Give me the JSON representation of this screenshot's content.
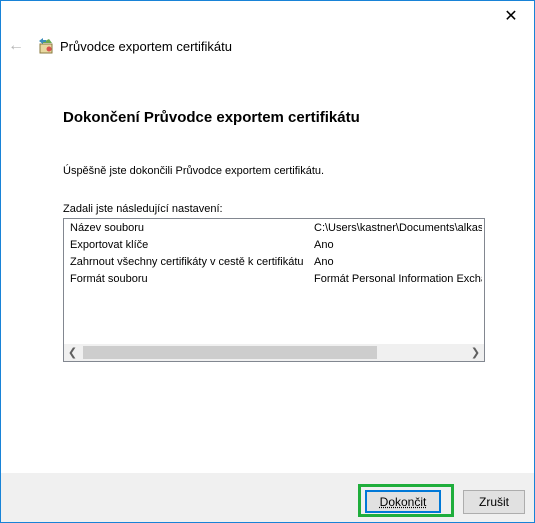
{
  "window": {
    "title": "Průvodce exportem certifikátu",
    "close_icon": "close-icon",
    "back_icon": "back-arrow-icon",
    "wizard_icon": "certificate-wizard-icon"
  },
  "content": {
    "heading": "Dokončení Průvodce exportem certifikátu",
    "success_text": "Úspěšně jste dokončili Průvodce exportem certifikátu.",
    "settings_label": "Zadali jste následující nastavení:"
  },
  "settings": [
    {
      "key": "Název souboru",
      "value": "C:\\Users\\kastner\\Documents\\alkas"
    },
    {
      "key": "Exportovat klíče",
      "value": "Ano"
    },
    {
      "key": "Zahrnout všechny certifikáty v cestě k certifikátu",
      "value": "Ano"
    },
    {
      "key": "Formát souboru",
      "value": "Formát Personal Information Excha"
    }
  ],
  "buttons": {
    "finish": "Dokončit",
    "cancel": "Zrušit"
  },
  "colors": {
    "window_border": "#1883d7",
    "highlight": "#1fae3c",
    "focus": "#0078d7"
  }
}
